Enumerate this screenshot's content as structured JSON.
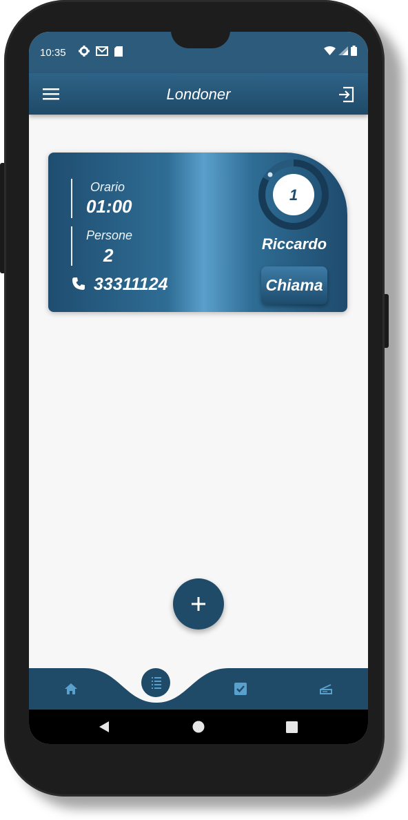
{
  "status_bar": {
    "time": "10:35"
  },
  "app_bar": {
    "title": "Londoner"
  },
  "booking": {
    "time_label": "Orario",
    "time_value": "01:00",
    "people_label": "Persone",
    "people_value": "2",
    "phone": "33311124",
    "queue_number": "1",
    "name": "Riccardo",
    "call_label": "Chiama"
  },
  "bottom_nav": [
    "home-icon",
    "list-icon",
    "checkbox-icon",
    "scanner-icon"
  ],
  "colors": {
    "primary": "#1f4a68",
    "accent": "#5aa0cc",
    "background": "#f7f7f7"
  }
}
